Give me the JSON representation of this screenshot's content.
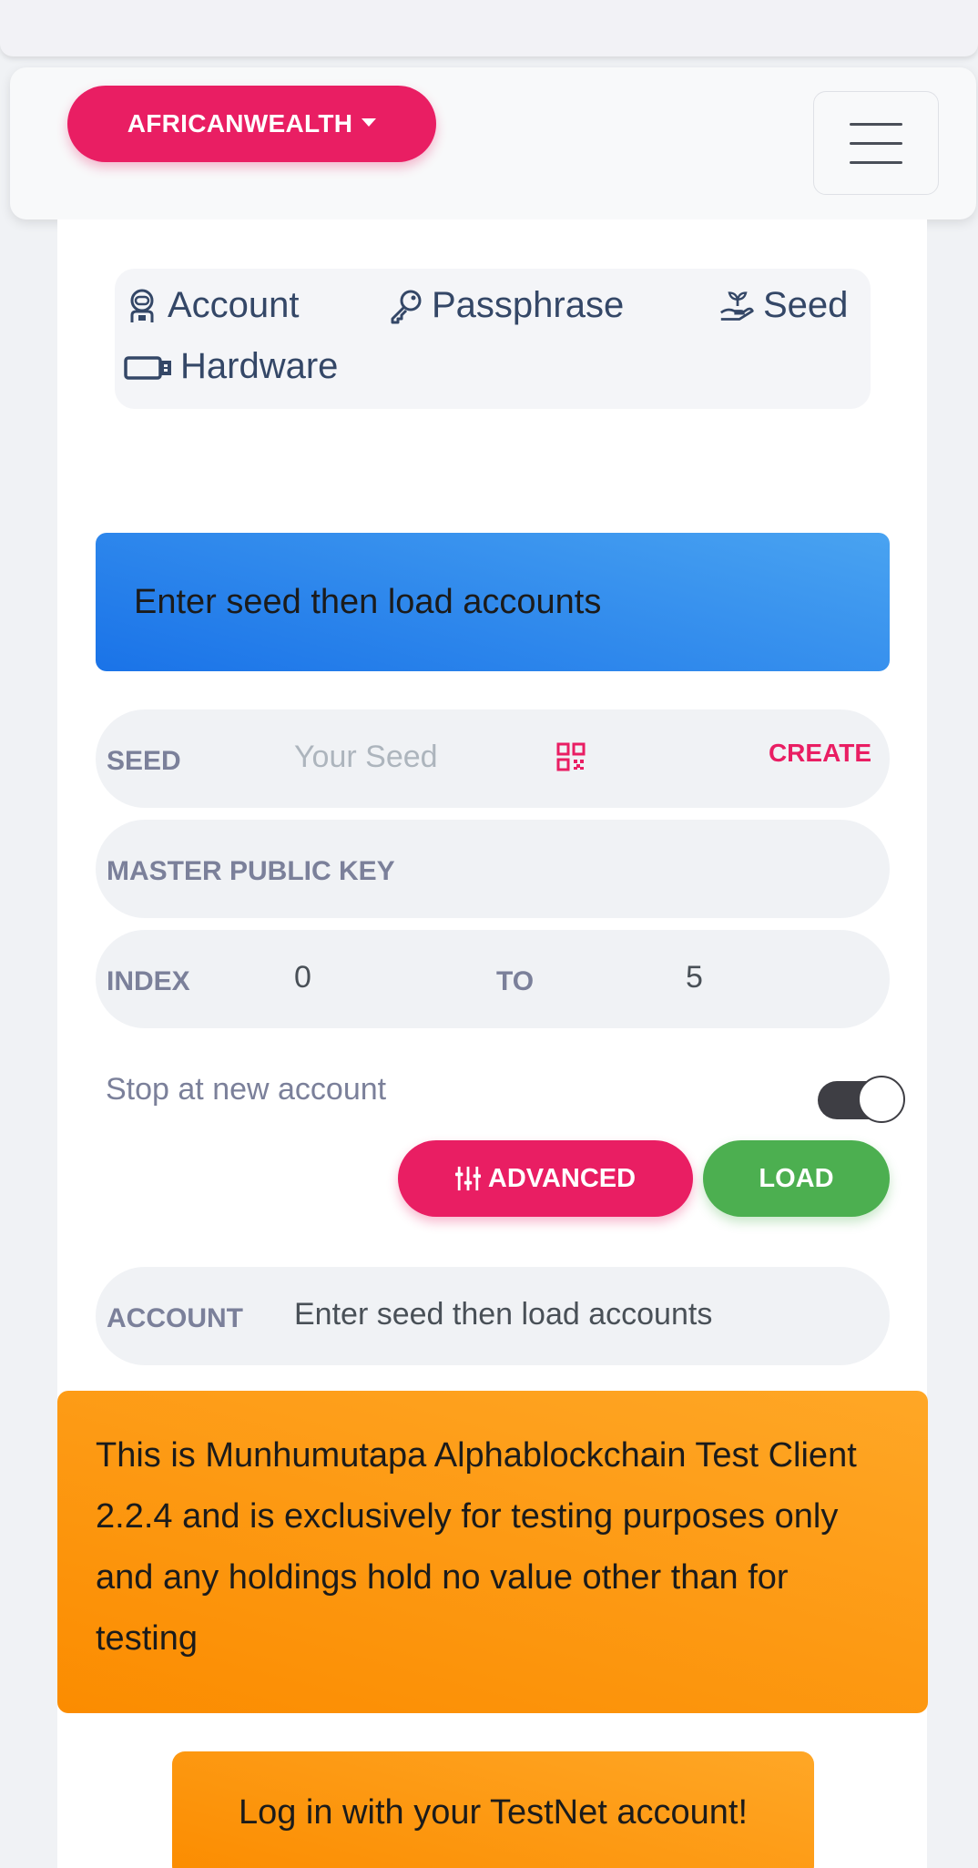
{
  "navbar": {
    "brand_label": "AFRICANWEALTH",
    "menu_icon": "hamburger-icon"
  },
  "tabs": [
    {
      "label": "Account",
      "icon": "astronaut-icon"
    },
    {
      "label": "Passphrase",
      "icon": "key-icon"
    },
    {
      "label": "Seed",
      "icon": "seedling-hand-icon"
    },
    {
      "label": "Hardware",
      "icon": "usb-drive-icon"
    }
  ],
  "info_alert": "Enter seed then load accounts",
  "form": {
    "seed": {
      "label": "SEED",
      "placeholder": "Your Seed",
      "create_label": "CREATE",
      "qr_icon": "qr-code-icon"
    },
    "master_key": {
      "label": "MASTER PUBLIC KEY"
    },
    "index": {
      "label": "INDEX",
      "from": "0",
      "to_label": "TO",
      "to": "5"
    },
    "stop_toggle": {
      "label": "Stop at new account",
      "on": true
    },
    "advanced_label": "ADVANCED",
    "load_label": "LOAD",
    "account": {
      "label": "ACCOUNT",
      "value": "Enter seed then load accounts"
    }
  },
  "warning": "This is Munhumutapa Alphablockchain Test Client 2.2.4 and is exclusively for testing purposes only and any holdings hold no value other than for testing",
  "login_prompt": "Log in with your TestNet account!",
  "colors": {
    "primary": "#e91e63",
    "success": "#4caf50",
    "info": "#1a73e8",
    "warning": "#fb8c00"
  }
}
